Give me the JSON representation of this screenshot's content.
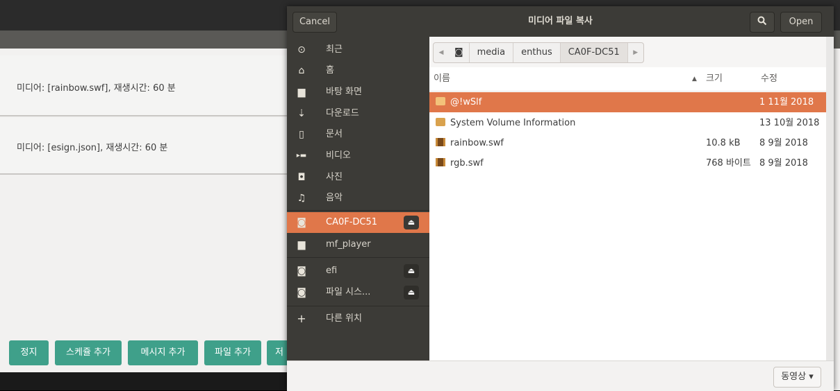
{
  "background_app": {
    "media_rows": [
      "미디어: [rainbow.swf], 재생시간: 60 분",
      "미디어: [esign.json], 재생시간: 60 분"
    ],
    "buttons": [
      "정지",
      "스케쥴 추가",
      "메시지 추가",
      "파일 추가",
      "저"
    ]
  },
  "dialog": {
    "title": "미디어 파일 복사",
    "cancel_label": "Cancel",
    "open_label": "Open",
    "sidebar": [
      {
        "icon": "clock-icon",
        "glyph": "⊙",
        "label": "최근"
      },
      {
        "icon": "home-icon",
        "glyph": "⌂",
        "label": "홈"
      },
      {
        "icon": "folder-icon",
        "glyph": "▆",
        "label": "바탕 화면"
      },
      {
        "icon": "download-icon",
        "glyph": "⇣",
        "label": "다운로드"
      },
      {
        "icon": "document-icon",
        "glyph": "▯",
        "label": "문서"
      },
      {
        "icon": "video-icon",
        "glyph": "▸▬",
        "label": "비디오"
      },
      {
        "icon": "camera-icon",
        "glyph": "◘",
        "label": "사진"
      },
      {
        "icon": "music-icon",
        "glyph": "♫",
        "label": "음악"
      },
      {
        "icon": "drive-icon",
        "glyph": "◙",
        "label": "CA0F-DC51",
        "eject": true,
        "selected": true
      },
      {
        "icon": "folder-icon",
        "glyph": "▆",
        "label": "mf_player"
      },
      {
        "icon": "drive-icon",
        "glyph": "◙",
        "label": "efi",
        "eject": true
      },
      {
        "icon": "drive-icon",
        "glyph": "◙",
        "label": "파일 시스...",
        "eject": true
      },
      {
        "icon": "plus-icon",
        "glyph": "+",
        "label": "다른 위치"
      }
    ],
    "breadcrumb": [
      "media",
      "enthus",
      "CA0F-DC51"
    ],
    "columns": {
      "name": "이름",
      "size": "크기",
      "modified": "수정"
    },
    "files": [
      {
        "type": "folder",
        "name": "@!wSlf",
        "size": "",
        "modified": "1 11월 2018",
        "selected": true
      },
      {
        "type": "folder",
        "name": "System Volume Information",
        "size": "",
        "modified": "13 10월 2018"
      },
      {
        "type": "video",
        "name": "rainbow.swf",
        "size": "10.8 kB",
        "modified": "8 9월 2018"
      },
      {
        "type": "video",
        "name": "rgb.swf",
        "size": "768 바이트",
        "modified": "8 9월 2018"
      }
    ],
    "filter_label": "동영상 ▾",
    "colors": {
      "accent": "#e0774a",
      "header": "#3c3b37",
      "green": "#3fa08a"
    }
  }
}
